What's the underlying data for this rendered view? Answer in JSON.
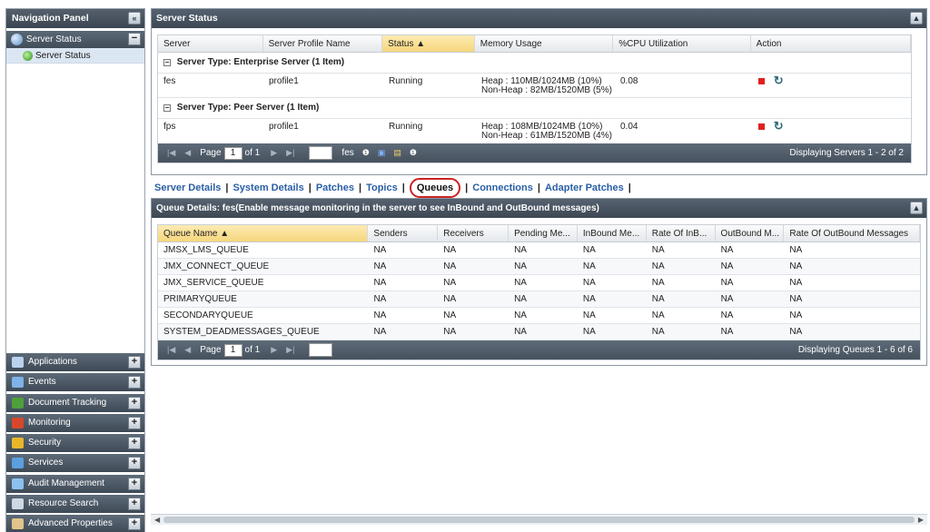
{
  "nav": {
    "title": "Navigation Panel",
    "collapse_glyph": "«",
    "active_section": {
      "label": "Server Status",
      "icon": "server-status-icon",
      "toggle": "−"
    },
    "active_subitem": {
      "label": "Server Status",
      "icon": "status-green-icon"
    },
    "items": [
      {
        "label": "Applications",
        "icon": "applications-icon",
        "color": "#b9d2ef",
        "toggle": "+"
      },
      {
        "label": "Events",
        "icon": "events-icon",
        "color": "#7fb2e8",
        "toggle": "+"
      },
      {
        "label": "Document Tracking",
        "icon": "document-tracking-icon",
        "color": "#4da13a",
        "toggle": "+"
      },
      {
        "label": "Monitoring",
        "icon": "monitoring-icon",
        "color": "#d9472b",
        "toggle": "+"
      },
      {
        "label": "Security",
        "icon": "security-icon",
        "color": "#e9b62a",
        "toggle": "+"
      },
      {
        "label": "Services",
        "icon": "services-icon",
        "color": "#5b9fe0",
        "toggle": "+"
      },
      {
        "label": "Audit Management",
        "icon": "audit-management-icon",
        "color": "#8cc0ee",
        "toggle": "+"
      },
      {
        "label": "Resource Search",
        "icon": "resource-search-icon",
        "color": "#cfd8e2",
        "toggle": "+"
      },
      {
        "label": "Advanced Properties",
        "icon": "advanced-properties-icon",
        "color": "#e0c58a",
        "toggle": "+"
      }
    ]
  },
  "server_status": {
    "title": "Server Status",
    "columns": [
      "Server",
      "Server Profile Name",
      "Status ▲",
      "Memory Usage",
      "%CPU Utilization",
      "Action"
    ],
    "groups": [
      {
        "toggle": "−",
        "label": "Server Type: Enterprise Server (1 Item)",
        "row": {
          "server": "fes",
          "profile": "profile1",
          "status": "Running",
          "heap": "Heap : 110MB/1024MB (10%)",
          "nonheap": "Non-Heap : 82MB/1520MB (5%)",
          "cpu": "0.08"
        }
      },
      {
        "toggle": "−",
        "label": "Server Type: Peer Server (1 Item)",
        "row": {
          "server": "fps",
          "profile": "profile1",
          "status": "Running",
          "heap": "Heap : 108MB/1024MB (10%)",
          "nonheap": "Non-Heap : 61MB/1520MB (4%)",
          "cpu": "0.04"
        }
      }
    ],
    "pager": {
      "page_label": "Page",
      "page_value": "1",
      "of_label": "of 1",
      "server_value": "fes",
      "display": "Displaying Servers 1 - 2 of 2"
    }
  },
  "tabs": {
    "server_details": "Server Details",
    "system_details": "System Details",
    "patches": "Patches",
    "topics": "Topics",
    "queues": "Queues",
    "connections": "Connections",
    "adapter_patches": "Adapter Patches",
    "sep": "|"
  },
  "queue_details": {
    "title": "Queue Details: fes(Enable message monitoring in the server to see InBound and OutBound messages)",
    "columns": [
      "Queue Name ▲",
      "Senders",
      "Receivers",
      "Pending Me...",
      "InBound Me...",
      "Rate Of InB...",
      "OutBound M...",
      "Rate Of OutBound Messages"
    ],
    "rows": [
      [
        "JMSX_LMS_QUEUE",
        "NA",
        "NA",
        "NA",
        "NA",
        "NA",
        "NA",
        "NA"
      ],
      [
        "JMX_CONNECT_QUEUE",
        "NA",
        "NA",
        "NA",
        "NA",
        "NA",
        "NA",
        "NA"
      ],
      [
        "JMX_SERVICE_QUEUE",
        "NA",
        "NA",
        "NA",
        "NA",
        "NA",
        "NA",
        "NA"
      ],
      [
        "PRIMARYQUEUE",
        "NA",
        "NA",
        "NA",
        "NA",
        "NA",
        "NA",
        "NA"
      ],
      [
        "SECONDARYQUEUE",
        "NA",
        "NA",
        "NA",
        "NA",
        "NA",
        "NA",
        "NA"
      ],
      [
        "SYSTEM_DEADMESSAGES_QUEUE",
        "NA",
        "NA",
        "NA",
        "NA",
        "NA",
        "NA",
        "NA"
      ]
    ],
    "pager": {
      "page_label": "Page",
      "page_value": "1",
      "of_label": "of 1",
      "display": "Displaying Queues 1 - 6 of 6"
    }
  },
  "colors": {
    "accent": "#2a5fa4",
    "header_dark": "#3d4854",
    "sort_highlight": "#f6d67c",
    "active_tab_ring": "#cc2222",
    "stop_icon": "#e02020"
  }
}
